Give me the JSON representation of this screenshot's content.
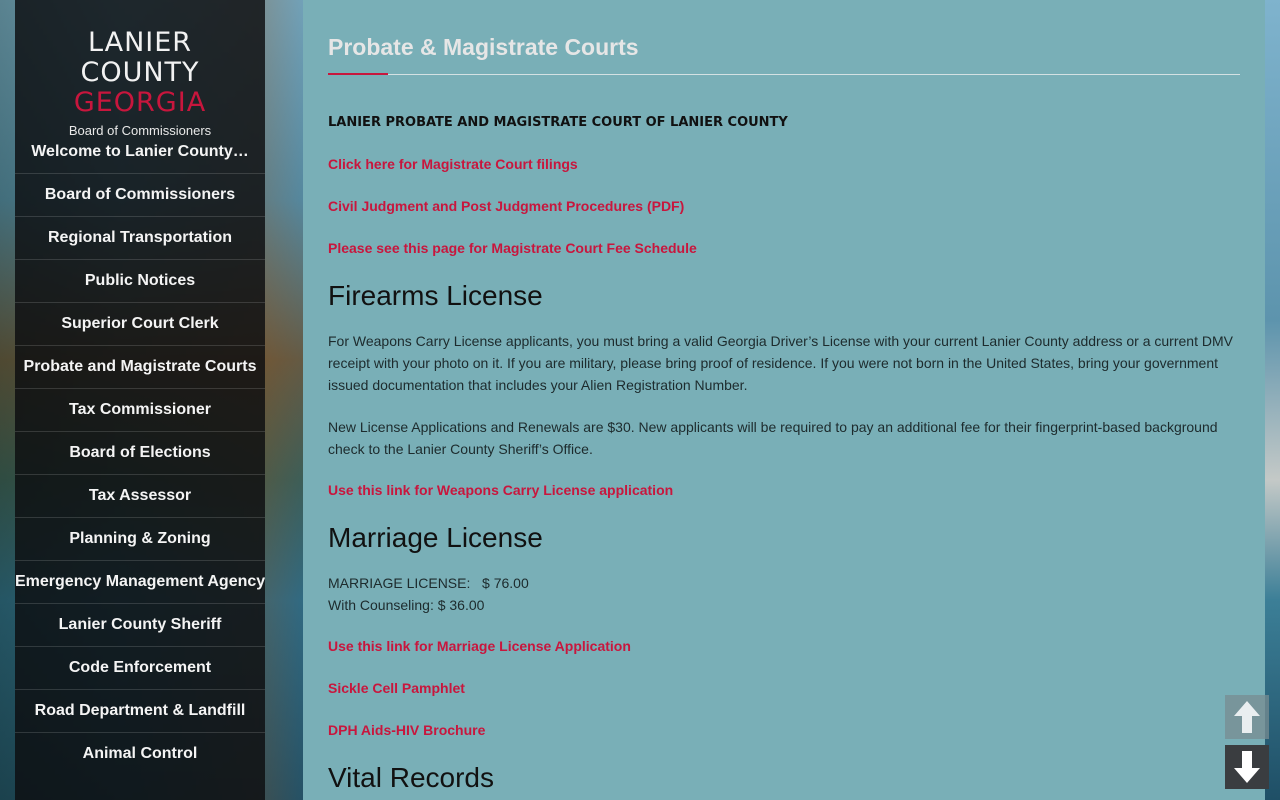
{
  "brand": {
    "line1": "LANIER",
    "line2": "COUNTY",
    "line3": "GEORGIA",
    "subtitle": "Board of Commissioners"
  },
  "nav": [
    "Welcome to Lanier County…",
    "Board of Commissioners",
    "Regional Transportation",
    "Public Notices",
    "Superior Court Clerk",
    "Probate and Magistrate Courts",
    "Tax Commissioner",
    "Board of Elections",
    "Tax Assessor",
    "Planning & Zoning",
    "Emergency Management Agency",
    "Lanier County Sheriff",
    "Code Enforcement",
    "Road Department & Landfill",
    "Animal Control"
  ],
  "main": {
    "title": "Probate & Magistrate Courts",
    "court_heading": "LANIER PROBATE AND MAGISTRATE COURT OF LANIER COUNTY",
    "links_top": [
      "Click here for Magistrate Court filings",
      "Civil Judgment and Post Judgment Procedures (PDF)",
      "Please see this page for Magistrate Court Fee Schedule"
    ],
    "firearms": {
      "heading": "Firearms License",
      "para1": "For Weapons Carry License applicants, you must bring a valid Georgia Driver’s License with your current Lanier County address or a current DMV receipt with your photo on it. If you are military, please bring proof of residence. If you were not born in the United States, bring your government issued documentation that includes your Alien Registration Number.",
      "para2": "New License Applications and Renewals are $30. New applicants will be required to pay an additional fee for their fingerprint-based background check to the Lanier County Sheriff’s Office.",
      "link": "Use this link for Weapons Carry License application"
    },
    "marriage": {
      "heading": "Marriage License",
      "fee_line1": "MARRIAGE LICENSE:   $ 76.00",
      "fee_line2": "With Counseling: $ 36.00",
      "links": [
        "Use this link for Marriage License Application",
        "Sickle Cell Pamphlet",
        "DPH Aids-HIV Brochure"
      ]
    },
    "vital": {
      "heading": "Vital Records"
    }
  },
  "icons": {
    "scroll_up": "arrow-up-icon",
    "scroll_down": "arrow-down-icon"
  },
  "colors": {
    "accent": "#c8163d",
    "panel": "#79afb7",
    "sidebar": "#0c0e10"
  }
}
